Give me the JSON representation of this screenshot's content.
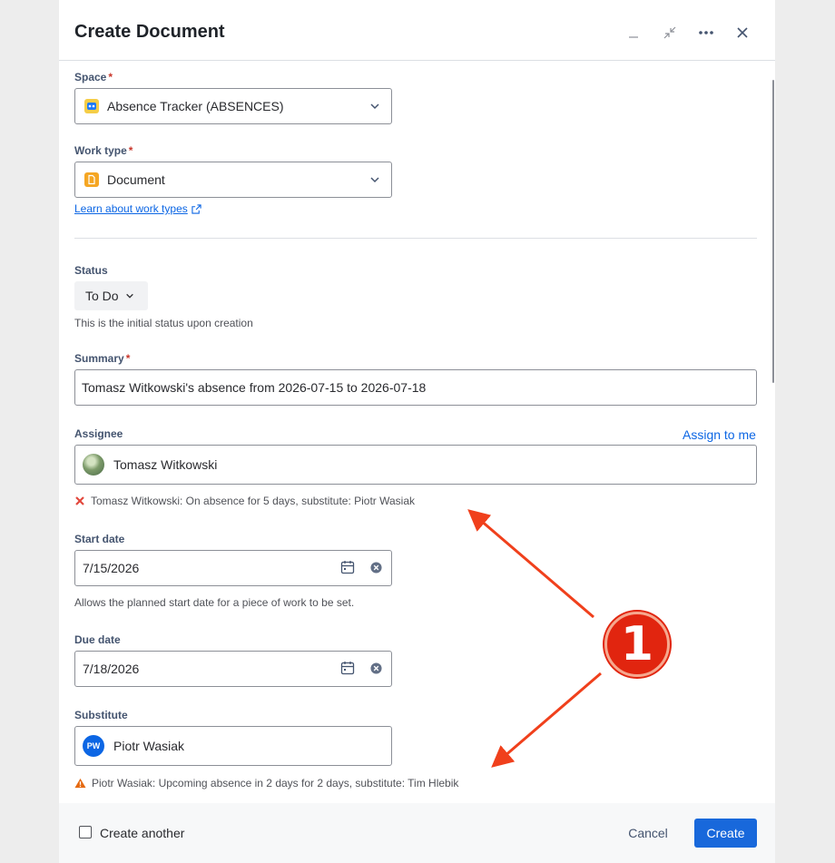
{
  "header": {
    "title": "Create Document"
  },
  "form": {
    "space": {
      "label": "Space",
      "required_mark": "*",
      "value": "Absence Tracker (ABSENCES)"
    },
    "work_type": {
      "label": "Work type",
      "required_mark": "*",
      "value": "Document",
      "learn_link": "Learn about work types"
    },
    "status": {
      "label": "Status",
      "value": "To Do",
      "help": "This is the initial status upon creation"
    },
    "summary": {
      "label": "Summary",
      "required_mark": "*",
      "value": "Tomasz Witkowski's absence from 2026-07-15 to 2026-07-18"
    },
    "assignee": {
      "label": "Assignee",
      "assign_to_me": "Assign to me",
      "value": "Tomasz Witkowski",
      "warning": "Tomasz Witkowski: On absence for 5 days, substitute: Piotr Wasiak"
    },
    "start_date": {
      "label": "Start date",
      "value": "7/15/2026",
      "help": "Allows the planned start date for a piece of work to be set."
    },
    "due_date": {
      "label": "Due date",
      "value": "7/18/2026"
    },
    "substitute": {
      "label": "Substitute",
      "initials": "PW",
      "value": "Piotr Wasiak",
      "warning": "Piotr Wasiak: Upcoming absence in 2 days for 2 days, substitute: Tim Hlebik"
    }
  },
  "footer": {
    "create_another": "Create another",
    "cancel": "Cancel",
    "create": "Create"
  },
  "annotation": {
    "badge_number": "1",
    "arrow_color": "#f0401c"
  },
  "colors": {
    "primary": "#1868db",
    "link": "#0c66e4",
    "required": "#c9372c",
    "error_icon": "#e2483d",
    "warning_icon": "#e56910"
  }
}
